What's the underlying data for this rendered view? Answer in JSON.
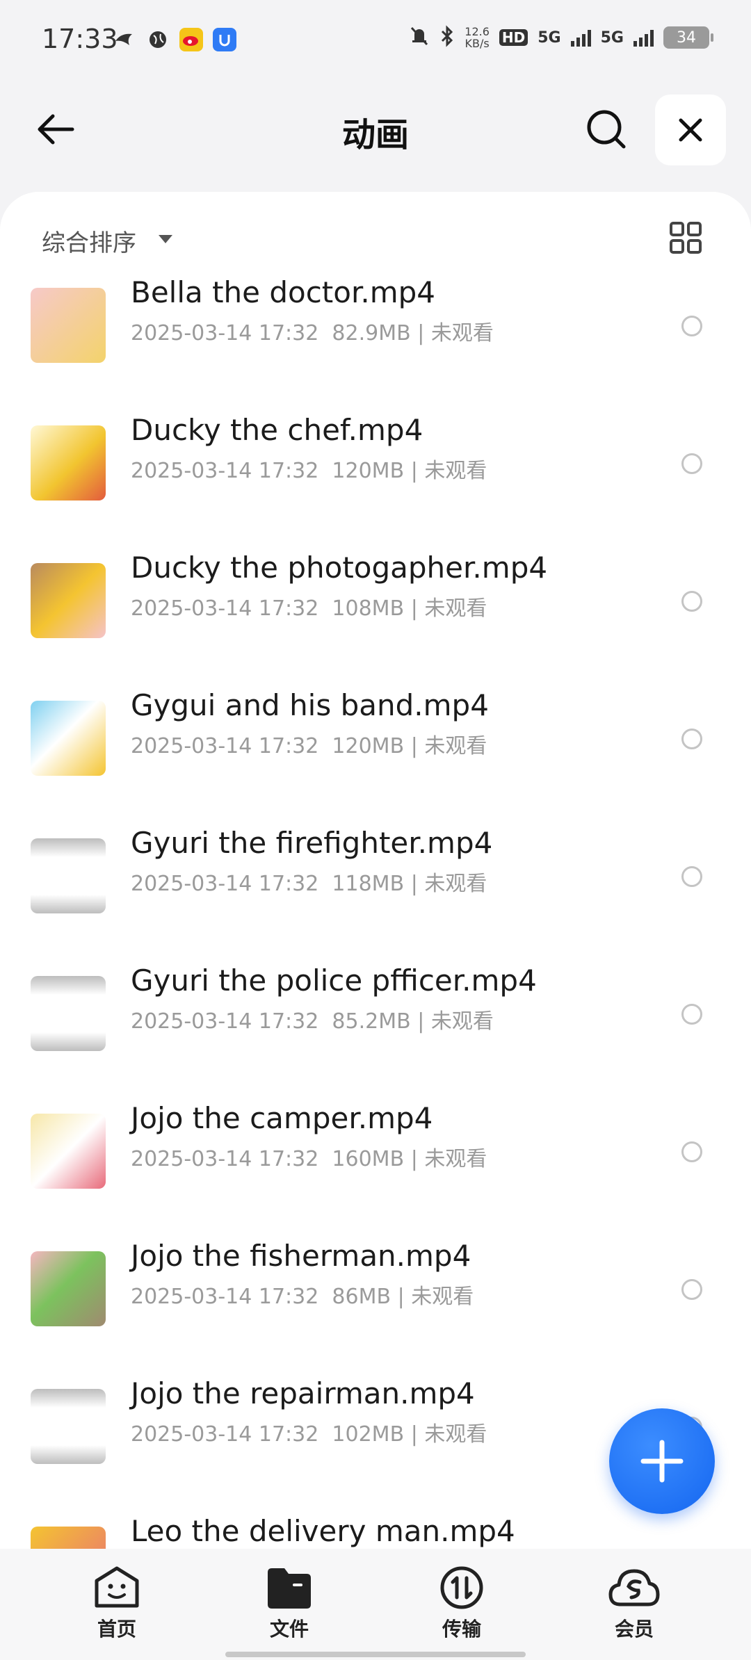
{
  "status_bar": {
    "time": "17:33",
    "left_icons": [
      "bird-app-icon",
      "globe-icon",
      "weibo-icon",
      "u-app-icon"
    ],
    "net_speed_value": "12.6",
    "net_speed_unit": "KB/s",
    "hd_label": "HD",
    "signal_1": "5G",
    "signal_2": "5G",
    "battery": "34"
  },
  "header": {
    "title": "动画"
  },
  "sort_bar": {
    "label": "综合排序"
  },
  "files": [
    {
      "name": "Bella the doctor.mp4",
      "date": "2025-03-14 17:32",
      "size": "82.9MB",
      "status": "未观看"
    },
    {
      "name": "Ducky the chef.mp4",
      "date": "2025-03-14 17:32",
      "size": "120MB",
      "status": "未观看"
    },
    {
      "name": "Ducky the photogapher.mp4",
      "date": "2025-03-14 17:32",
      "size": "108MB",
      "status": "未观看"
    },
    {
      "name": "Gygui and his band.mp4",
      "date": "2025-03-14 17:32",
      "size": "120MB",
      "status": "未观看"
    },
    {
      "name": "Gyuri the firefighter.mp4",
      "date": "2025-03-14 17:32",
      "size": "118MB",
      "status": "未观看"
    },
    {
      "name": "Gyuri the police pfficer.mp4",
      "date": "2025-03-14 17:32",
      "size": "85.2MB",
      "status": "未观看"
    },
    {
      "name": "Jojo the camper.mp4",
      "date": "2025-03-14 17:32",
      "size": "160MB",
      "status": "未观看"
    },
    {
      "name": "Jojo the fisherman.mp4",
      "date": "2025-03-14 17:32",
      "size": "86MB",
      "status": "未观看"
    },
    {
      "name": "Jojo the repairman.mp4",
      "date": "2025-03-14 17:32",
      "size": "102MB",
      "status": "未观看"
    },
    {
      "name": "Leo the delivery man.mp4",
      "date": "",
      "size": "",
      "status": ""
    }
  ],
  "bottom_nav": [
    {
      "label": "首页",
      "icon": "smile-home-icon"
    },
    {
      "label": "文件",
      "icon": "folder-icon"
    },
    {
      "label": "传输",
      "icon": "transfer-icon"
    },
    {
      "label": "会员",
      "icon": "cloud-member-icon"
    }
  ],
  "colors": {
    "accent": "#1466f0",
    "meta_text": "#9a9a9a",
    "background": "#f3f3f5"
  }
}
